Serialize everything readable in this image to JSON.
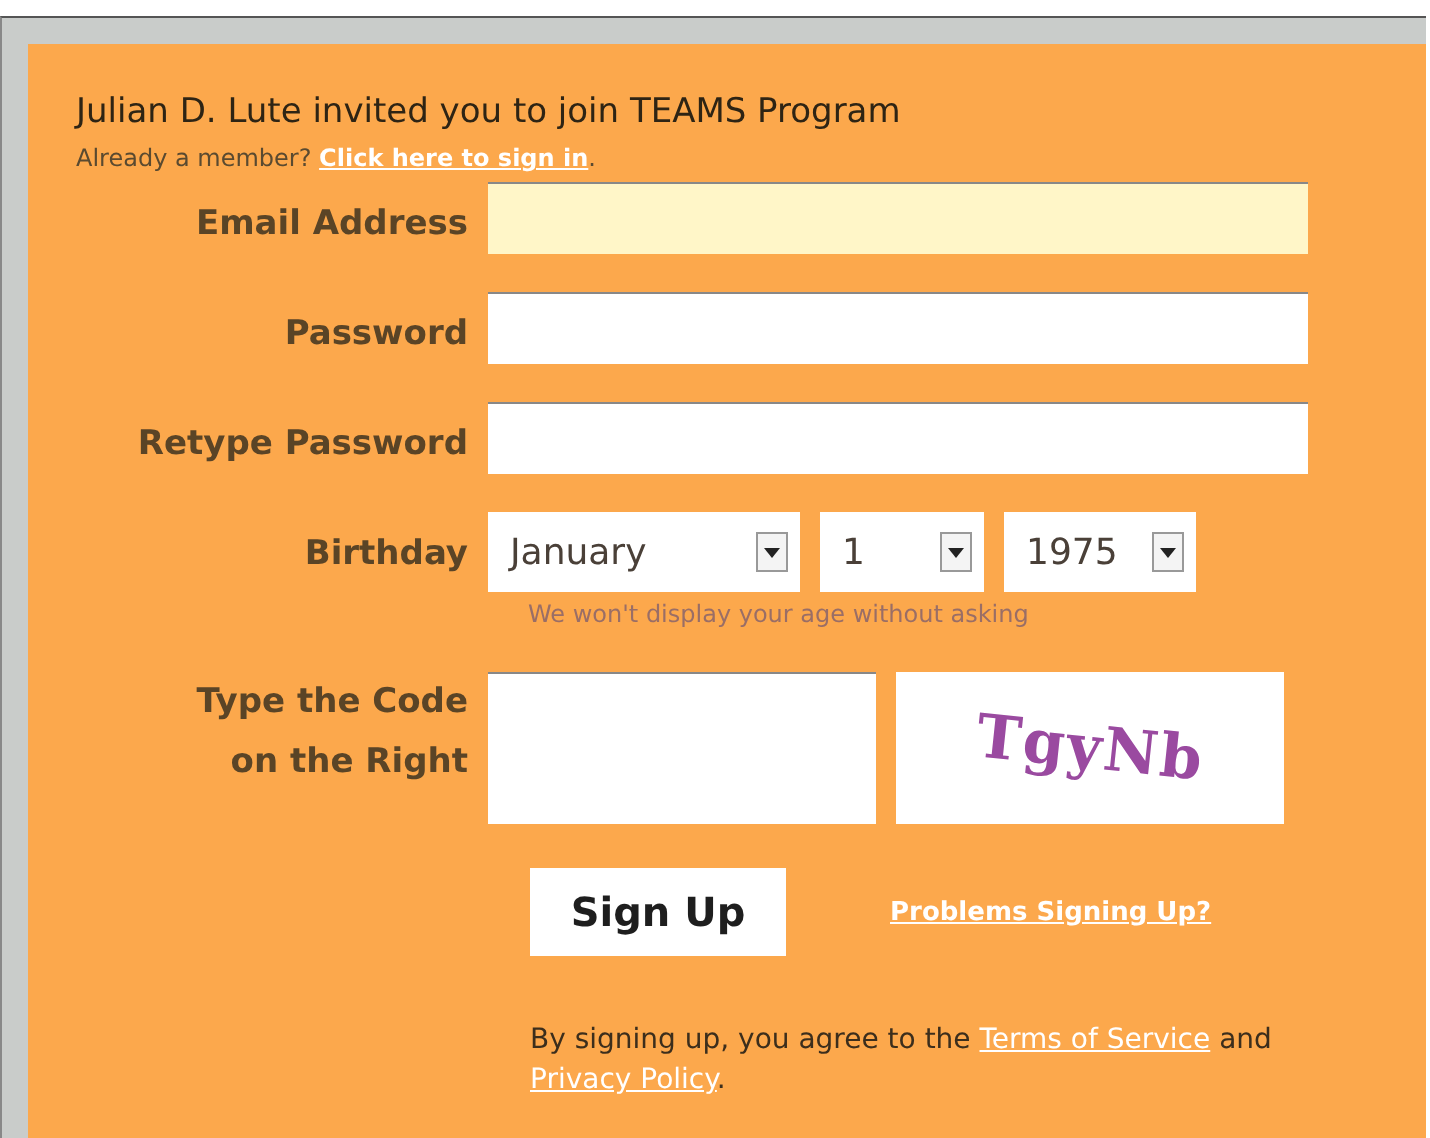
{
  "invite_title": "Julian D. Lute invited you to join TEAMS Program",
  "member_prompt": {
    "text": "Already a member?",
    "link": "Click here to sign in",
    "after": "."
  },
  "fields": [
    {
      "label": "Email Address",
      "focused": true
    },
    {
      "label": "Password",
      "focused": false
    },
    {
      "label": "Retype Password",
      "focused": false
    }
  ],
  "birthday": {
    "label": "Birthday",
    "selects": [
      {
        "value": "January"
      },
      {
        "value": "1"
      },
      {
        "value": "1975"
      }
    ],
    "hint": "We won't display your age without asking"
  },
  "captcha": {
    "label_lines": [
      "Type the Code",
      "on the Right"
    ],
    "code": "TgyNb"
  },
  "sign_up_button": "Sign Up",
  "problems_link": "Problems Signing Up?",
  "terms": {
    "before": "By signing up, you agree to the",
    "terms_link": "Terms of Service",
    "middle": "and",
    "privacy_link": "Privacy Policy",
    "after": "."
  }
}
